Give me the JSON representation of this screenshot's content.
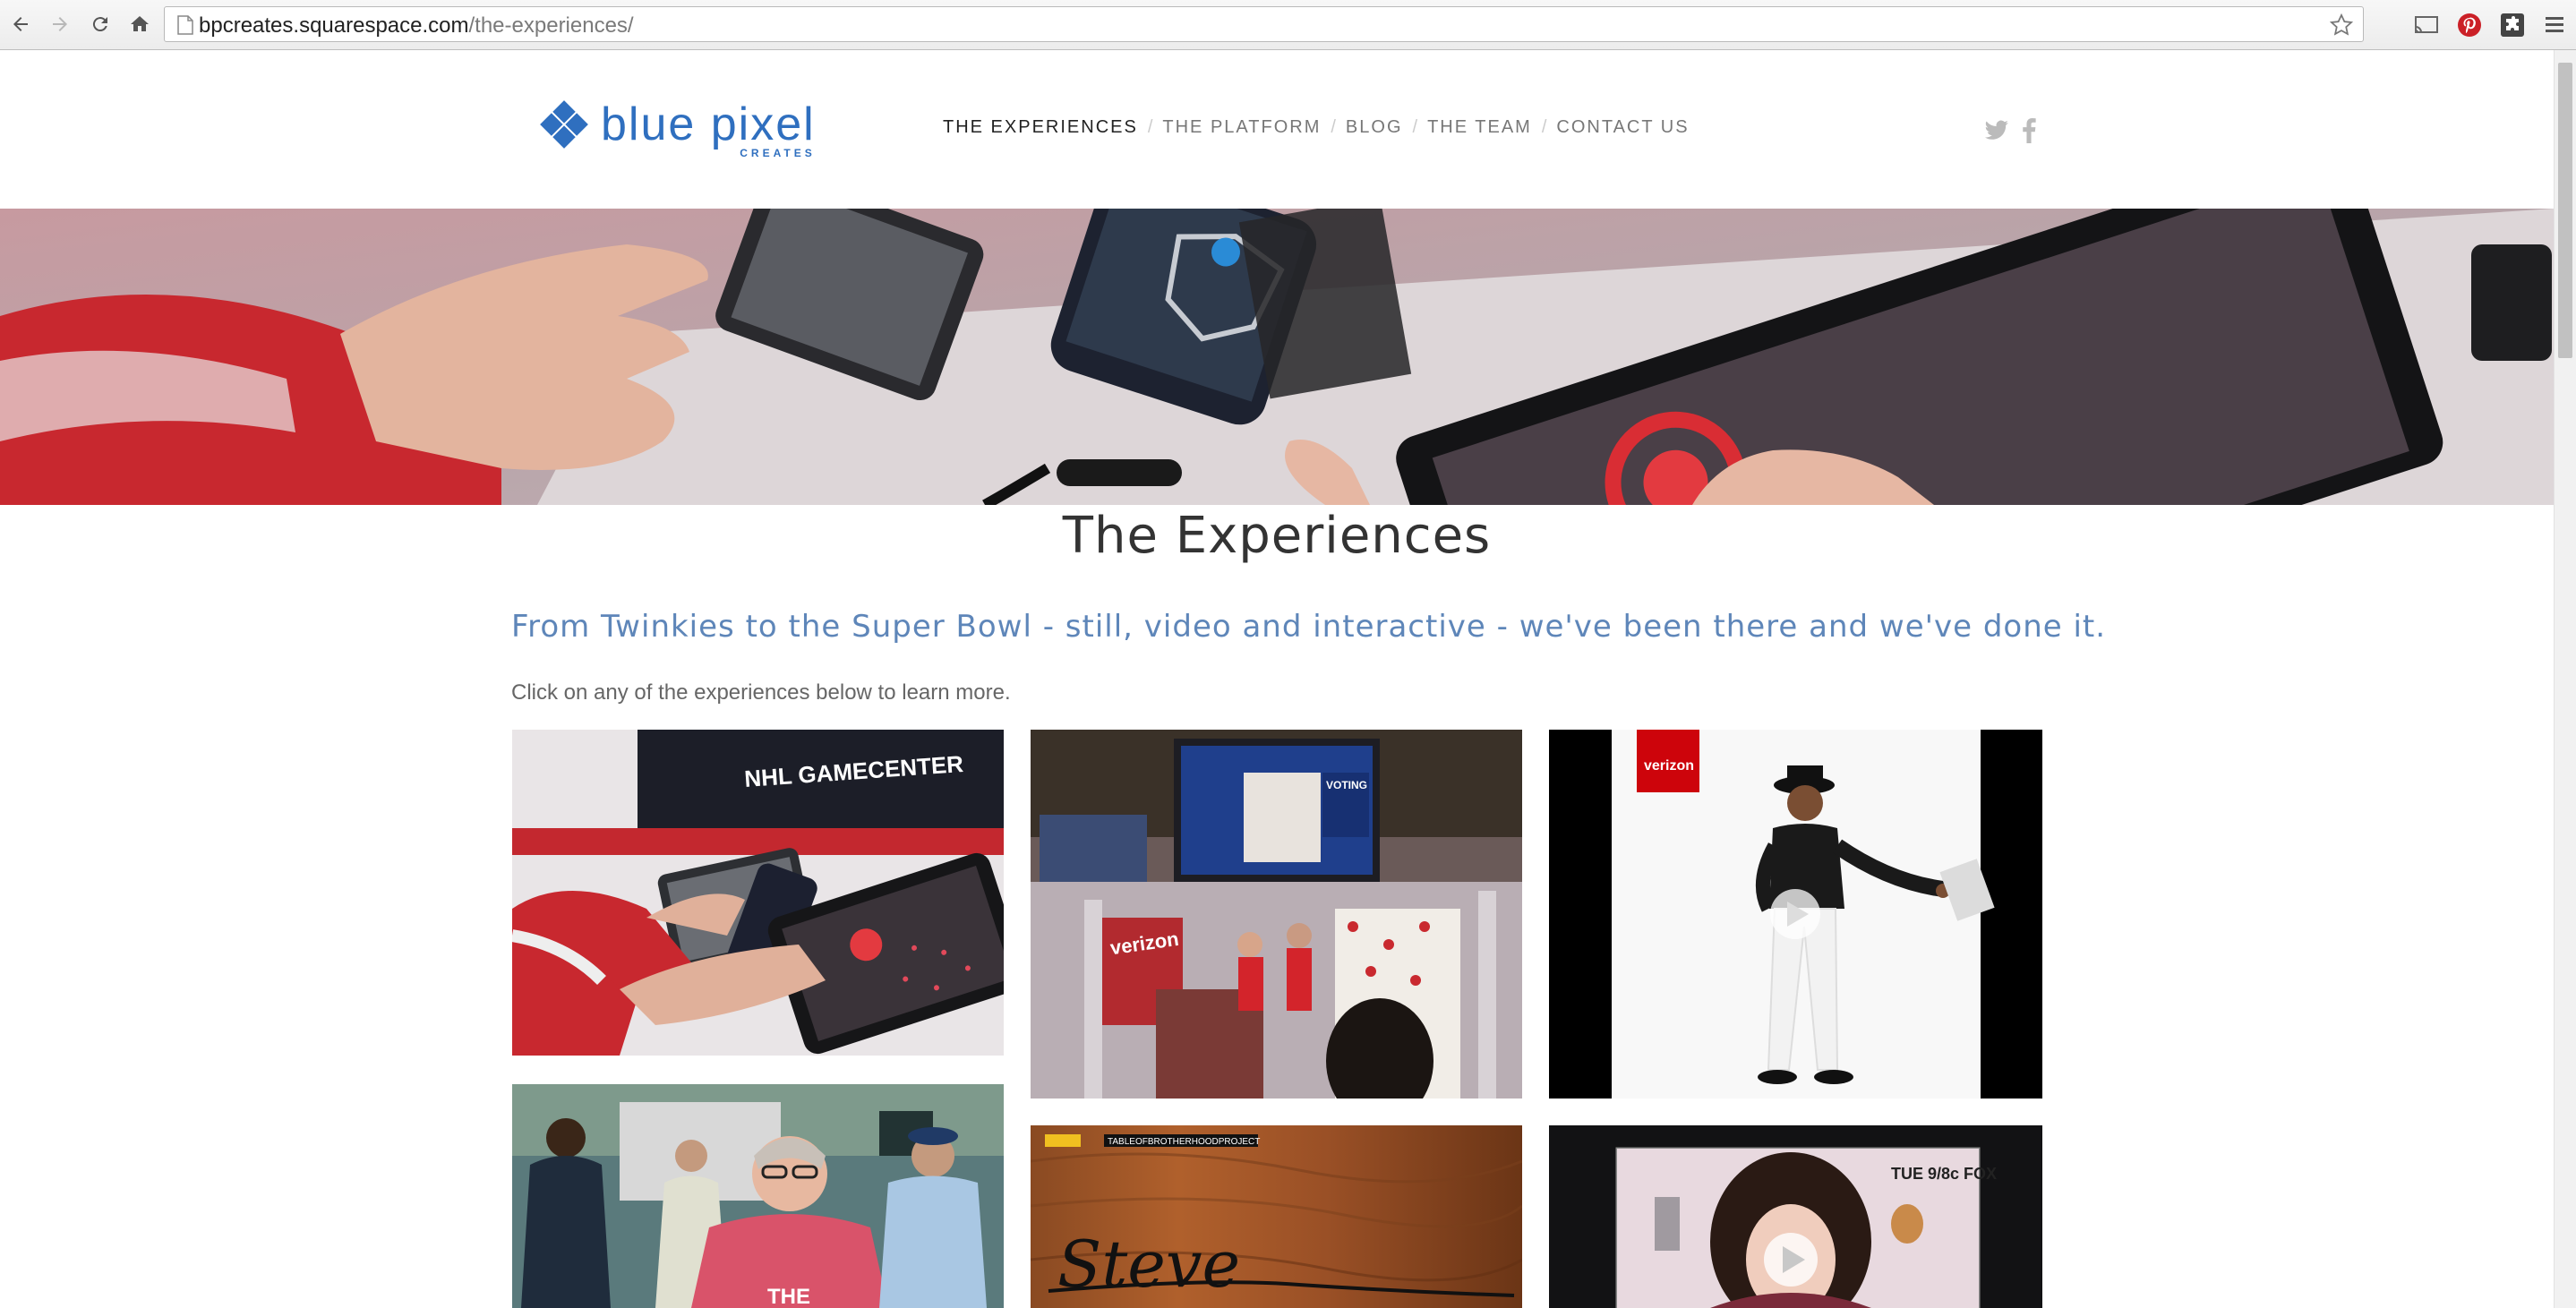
{
  "browser": {
    "url_host": "bpcreates.squarespace.com",
    "url_path": "/the-experiences/",
    "nav_icons": [
      "back-icon",
      "forward-icon",
      "reload-icon",
      "home-icon"
    ],
    "extension_icons": [
      "cast-icon",
      "pinterest-icon",
      "extension-icon",
      "menu-icon"
    ]
  },
  "site": {
    "logo_main": "blue pixel",
    "logo_sub": "CREATES",
    "brand_color": "#2f6fbf",
    "nav": [
      {
        "label": "THE EXPERIENCES",
        "active": true
      },
      {
        "label": "THE PLATFORM"
      },
      {
        "label": "BLOG"
      },
      {
        "label": "THE TEAM"
      },
      {
        "label": "CONTACT US"
      }
    ],
    "nav_separator": "/",
    "social_icons": [
      "twitter-icon",
      "facebook-icon"
    ]
  },
  "content": {
    "title": "The Experiences",
    "tagline": "From Twinkies to the Super Bowl - still, video and interactive - we've been there and we've done it.",
    "intro": "Click on any of the experiences below to learn more.",
    "tiles": [
      {
        "name": "nhl-gamecenter",
        "text": "NHL GAMECENTER"
      },
      {
        "name": "verizon-voting-booth",
        "text": "VOTING",
        "badge": "verizon"
      },
      {
        "name": "verizon-dancer-video",
        "badge": "verizon",
        "video": true
      },
      {
        "name": "crowd-photo",
        "text": "THE"
      },
      {
        "name": "table-of-brotherhood",
        "text": "TABLEOFBROTHERHOODPROJECT",
        "signature": "Steve"
      },
      {
        "name": "fox-new-girl-video",
        "text": "TUE 9/8c FOX",
        "video": true
      }
    ]
  }
}
